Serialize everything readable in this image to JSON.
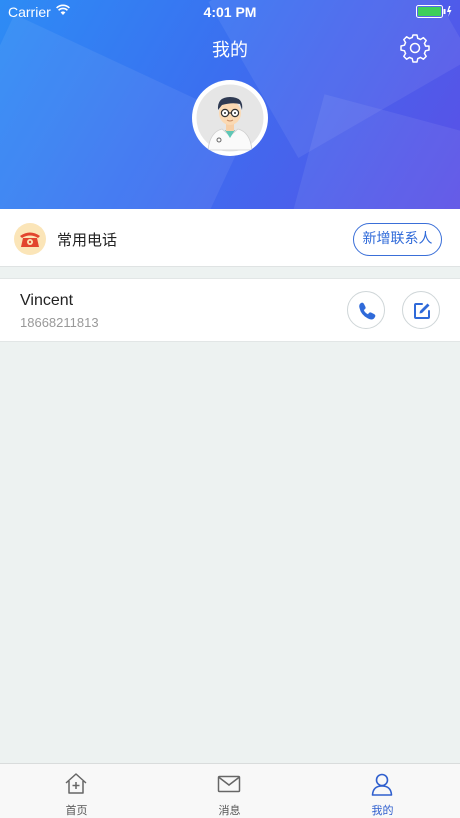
{
  "status_bar": {
    "carrier": "Carrier",
    "time": "4:01 PM"
  },
  "header": {
    "title": "我的",
    "gradient_start": "#2d8cf5",
    "gradient_end": "#5b4fe6"
  },
  "common_phone": {
    "label": "常用电话",
    "add_button_label": "新增联系人",
    "icon": "telephone-icon"
  },
  "contacts": [
    {
      "name": "Vincent",
      "phone": "18668211813"
    }
  ],
  "tabs": [
    {
      "label": "首页",
      "icon": "home-plus-icon",
      "active": false
    },
    {
      "label": "消息",
      "icon": "mail-icon",
      "active": false
    },
    {
      "label": "我的",
      "icon": "user-icon",
      "active": true
    }
  ],
  "colors": {
    "accent": "#2f6ad9",
    "active_tab": "#2f5fce",
    "background": "#edf2f1"
  }
}
